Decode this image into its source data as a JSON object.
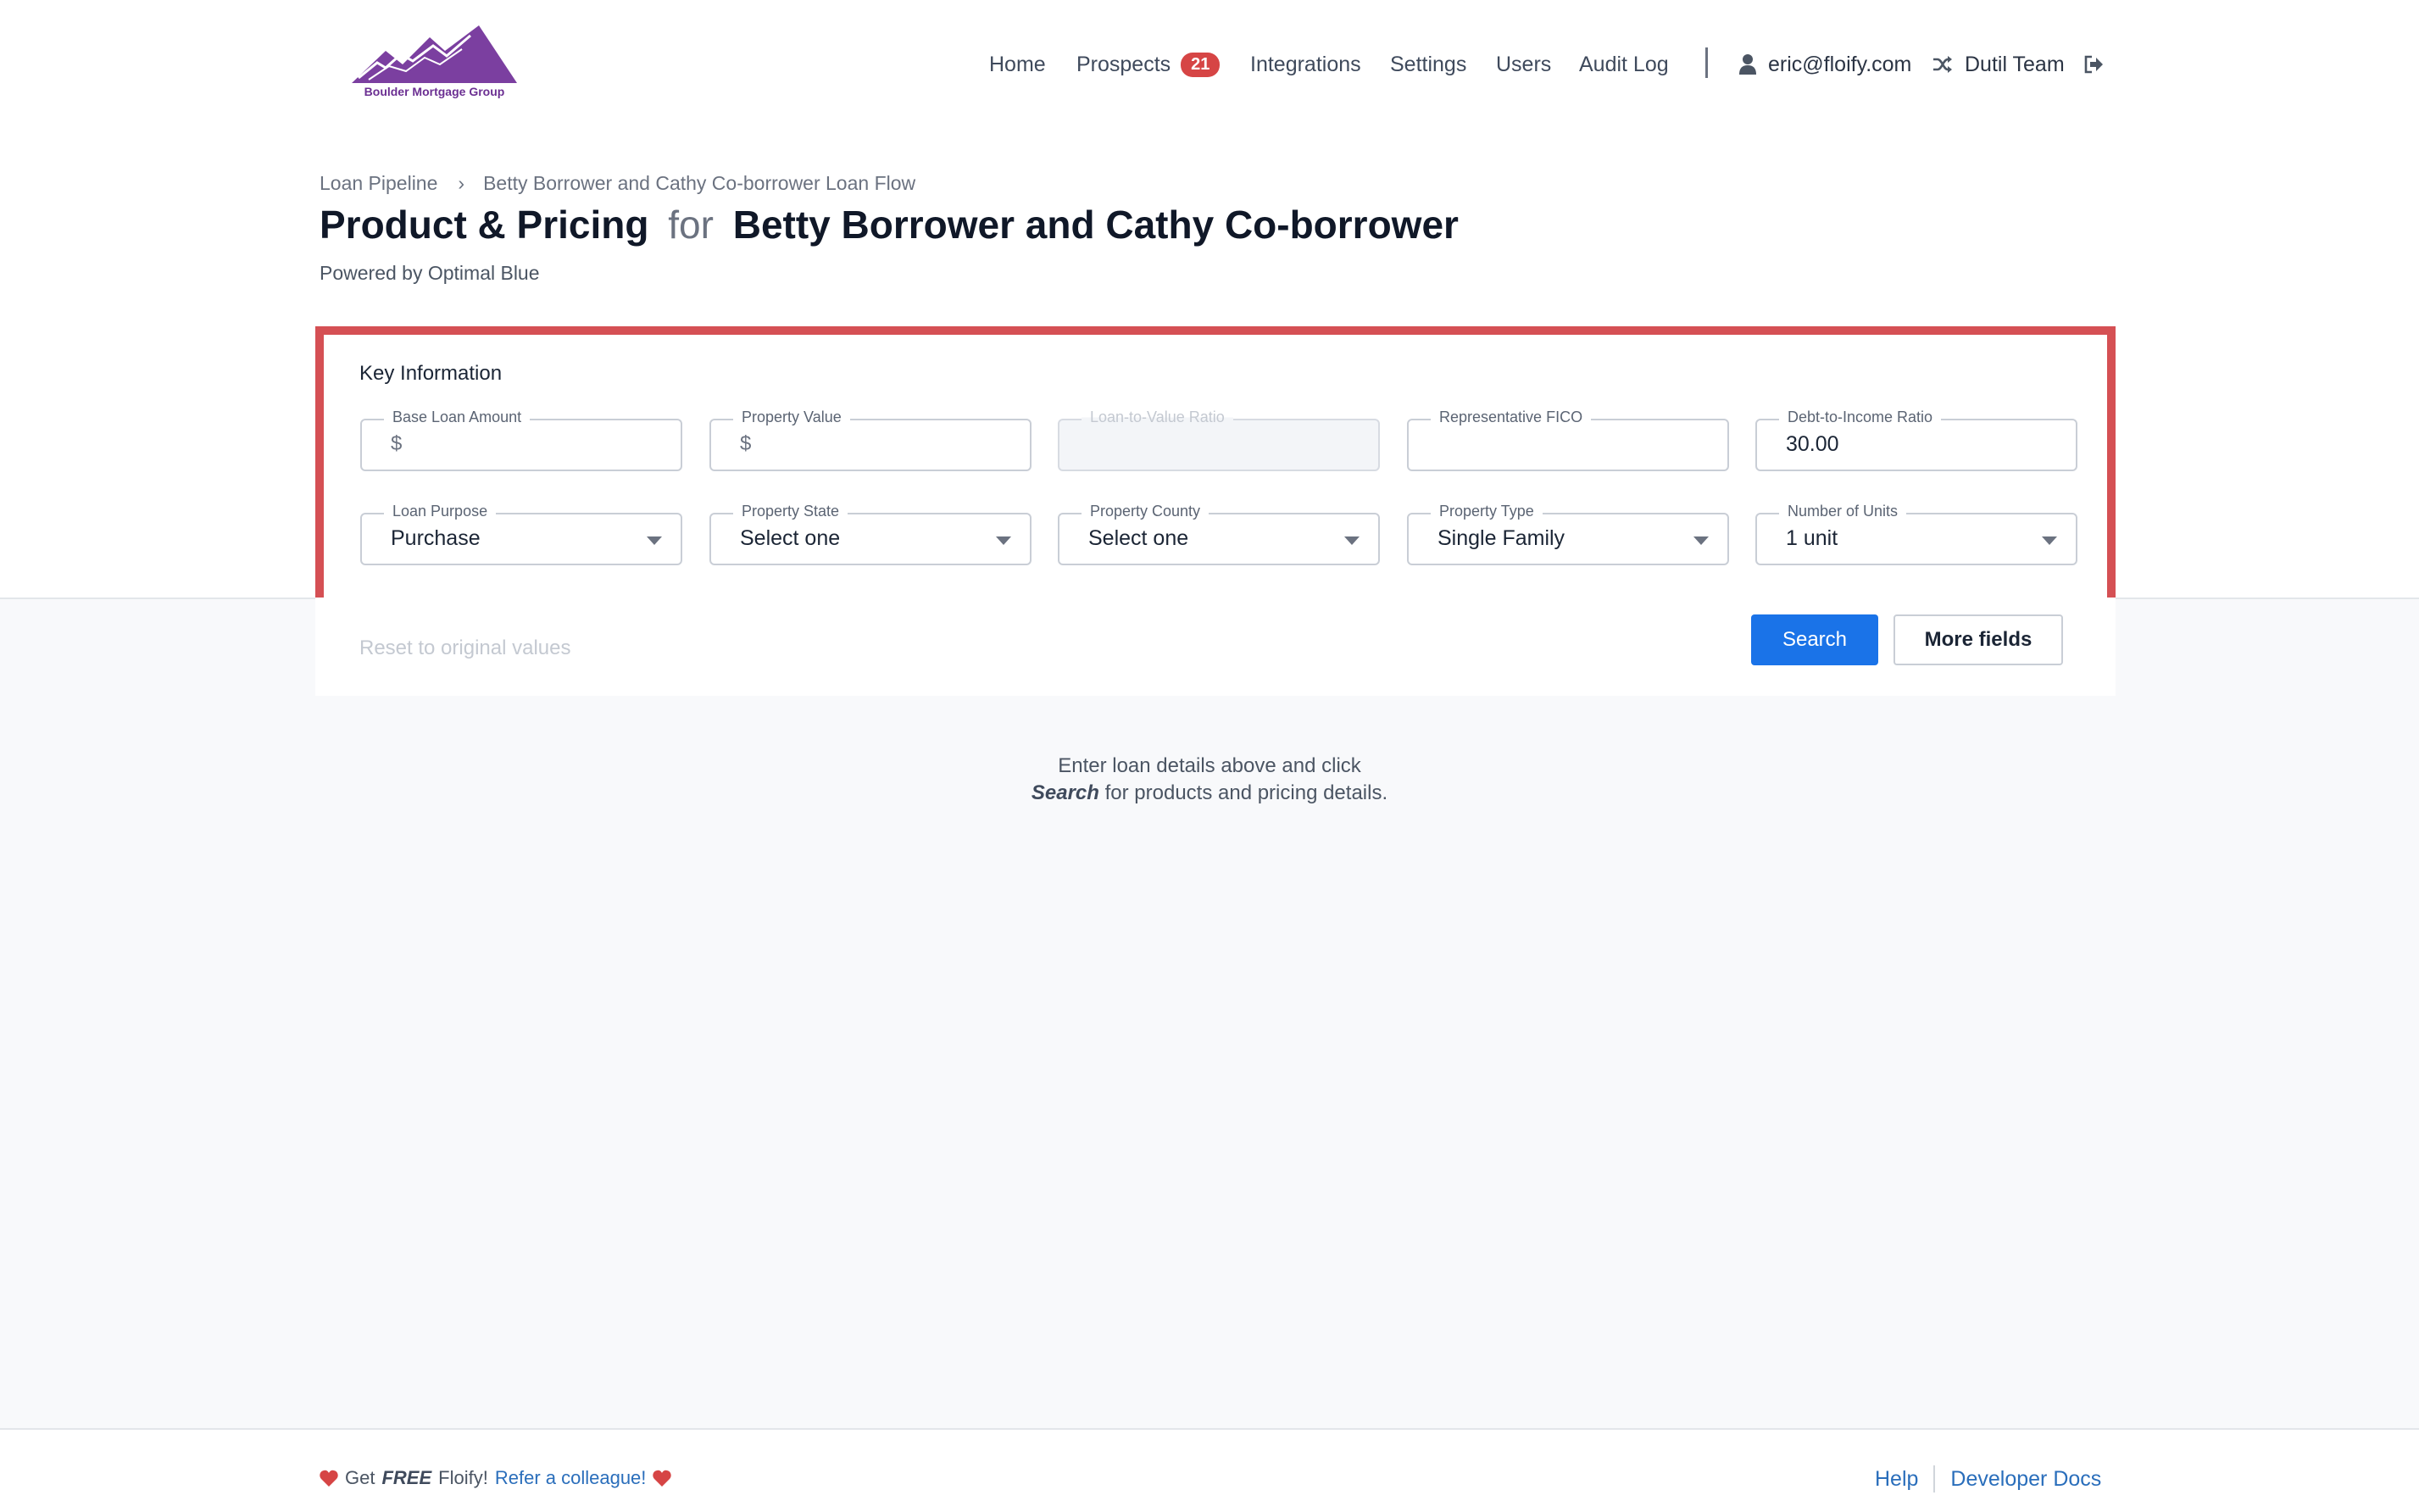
{
  "header": {
    "logo_text": "Boulder Mortgage Group",
    "nav": [
      {
        "label": "Home"
      },
      {
        "label": "Prospects",
        "badge": "21"
      },
      {
        "label": "Integrations"
      },
      {
        "label": "Settings"
      },
      {
        "label": "Users"
      },
      {
        "label": "Audit Log"
      }
    ],
    "user_email": "eric@floify.com",
    "team_name": "Dutil Team",
    "icons": {
      "user": "user-icon",
      "team": "shuffle-icon",
      "logout": "sign-out-icon"
    }
  },
  "breadcrumb": {
    "items": [
      "Loan Pipeline",
      "Betty Borrower and Cathy Co-borrower Loan Flow"
    ],
    "separator": "›"
  },
  "title": {
    "main": "Product & Pricing",
    "connector": "for",
    "borrowers": "Betty Borrower and Cathy Co-borrower"
  },
  "subtitle": "Powered by Optimal Blue",
  "key_info": {
    "title": "Key Information",
    "fields": [
      {
        "label": "Base Loan Amount",
        "prefix": "$",
        "value": ""
      },
      {
        "label": "Property Value",
        "prefix": "$",
        "value": ""
      },
      {
        "label": "Loan-to-Value Ratio",
        "value": "",
        "disabled": true
      },
      {
        "label": "Representative FICO",
        "value": ""
      },
      {
        "label": "Debt-to-Income Ratio",
        "value": "30.00"
      },
      {
        "label": "Loan Purpose",
        "value": "Purchase",
        "type": "select"
      },
      {
        "label": "Property State",
        "value": "Select one",
        "type": "select"
      },
      {
        "label": "Property County",
        "value": "Select one",
        "type": "select"
      },
      {
        "label": "Property Type",
        "value": "Single Family",
        "type": "select"
      },
      {
        "label": "Number of Units",
        "value": "1 unit",
        "type": "select"
      }
    ],
    "reset_label": "Reset to original values",
    "search_label": "Search",
    "more_fields_label": "More fields"
  },
  "empty_state": {
    "line1": "Enter loan details above and click",
    "line2_bold": "Search",
    "line2_rest": " for products and pricing details."
  },
  "footer": {
    "get": "Get",
    "free": "FREE",
    "brand": "Floify!",
    "refer": "Refer a colleague!",
    "help": "Help",
    "developer_docs": "Developer Docs"
  },
  "colors": {
    "accent": "#1a73e8",
    "highlight_border": "#d55054",
    "badge": "#d64545",
    "logo": "#7b3fa0",
    "heart": "#d64545",
    "link": "#2a6ebb"
  }
}
